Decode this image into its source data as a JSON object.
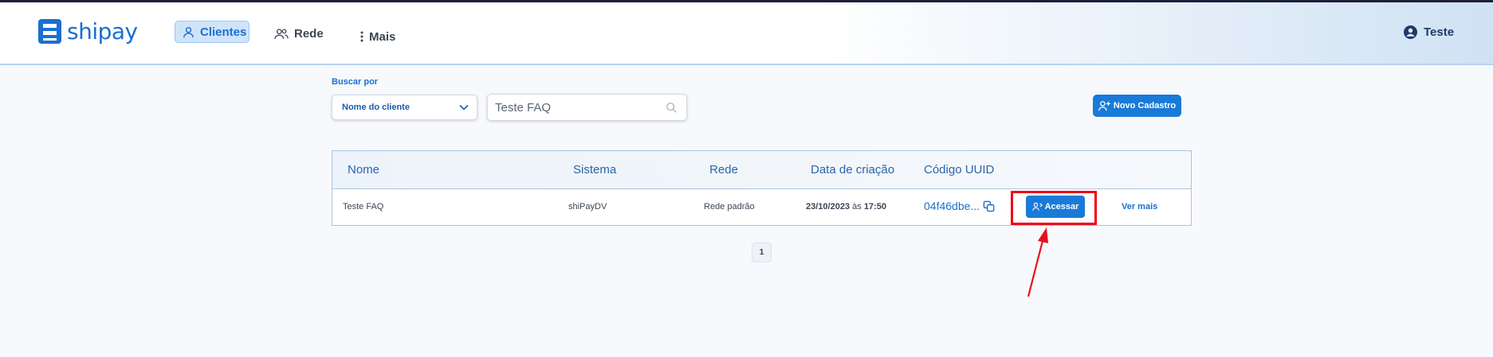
{
  "brand": {
    "name": "shipay"
  },
  "nav": {
    "clientes": "Clientes",
    "rede": "Rede",
    "mais": "Mais"
  },
  "user": {
    "name": "Teste"
  },
  "search": {
    "label": "Buscar por",
    "select_value": "Nome do cliente",
    "input_value": "Teste FAQ"
  },
  "actions": {
    "new_label": "Novo Cadastro"
  },
  "table": {
    "headers": [
      "Nome",
      "Sistema",
      "Rede",
      "Data de criação",
      "Código UUID"
    ],
    "rows": [
      {
        "nome": "Teste FAQ",
        "sistema": "shiPayDV",
        "rede": "Rede padrão",
        "data": "23/10/2023",
        "data_sep": "às",
        "hora": "17:50",
        "uuid": "04f46dbe...",
        "acessar": "Acessar",
        "ver_mais": "Ver mais"
      }
    ]
  },
  "pagination": {
    "current": "1"
  },
  "colors": {
    "accent": "#1a7ad8",
    "highlight": "#f0000f"
  }
}
